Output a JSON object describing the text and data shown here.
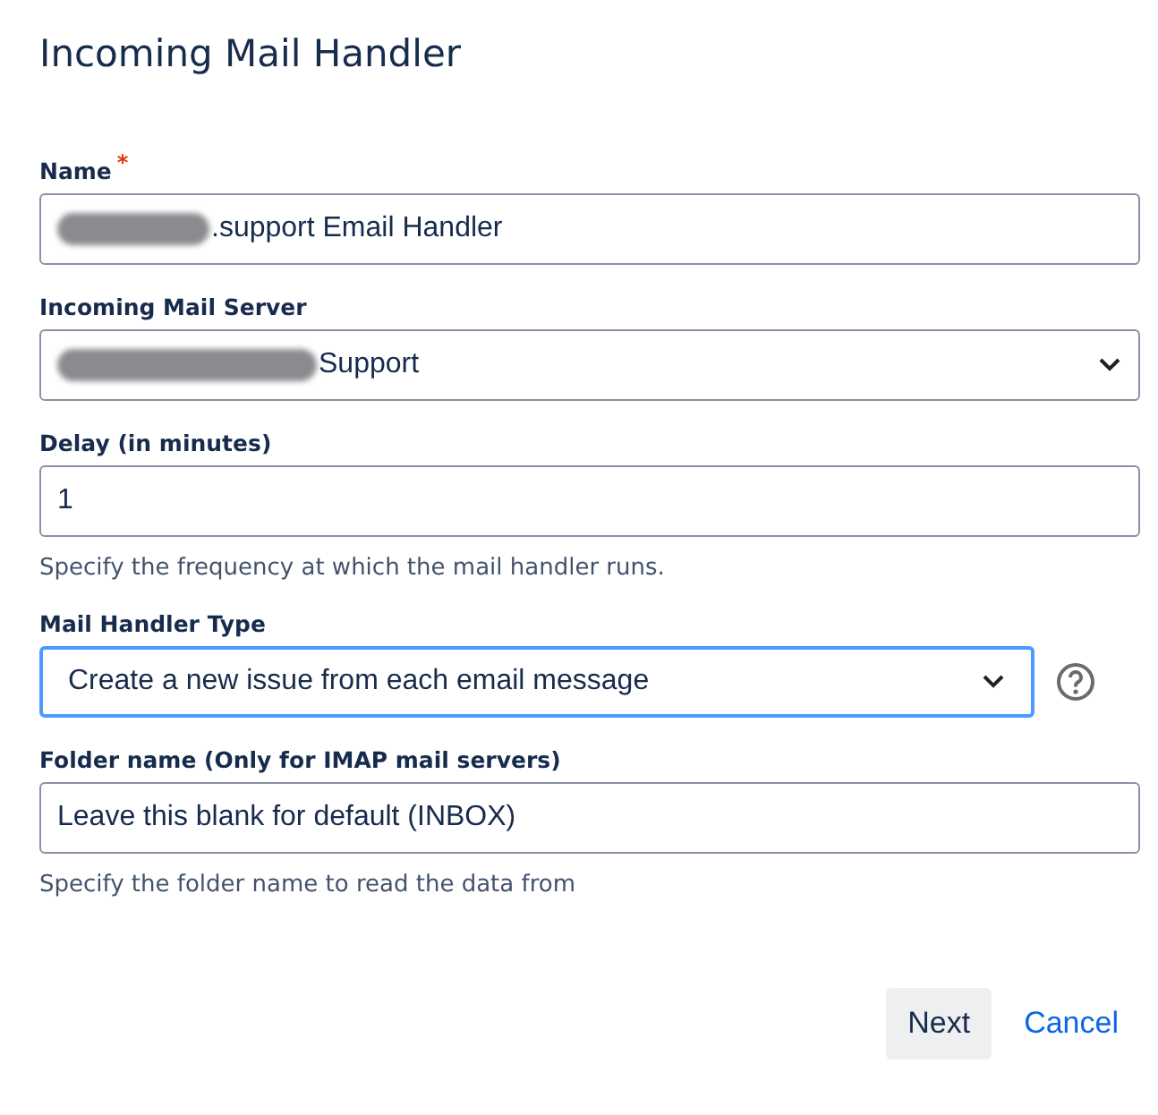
{
  "dialog": {
    "title": "Incoming Mail Handler"
  },
  "fields": [
    {
      "kind": "text",
      "label": "Name",
      "required_mark": "*",
      "value": ".support Email Handler",
      "redacted": true,
      "focused": false
    },
    {
      "kind": "select",
      "label": "Incoming Mail Server",
      "value": "Support",
      "redacted": true,
      "focused": false
    },
    {
      "kind": "text",
      "label": "Delay (in minutes)",
      "value": "1",
      "redacted": false,
      "focused": false,
      "help": "Specify the frequency at which the mail handler runs."
    },
    {
      "kind": "select",
      "label": "Mail Handler Type",
      "value": "Create a new issue from each email message",
      "redacted": false,
      "focused": true,
      "info": true
    },
    {
      "kind": "text",
      "label": "Folder name (Only for IMAP mail servers)",
      "value": "Leave this blank for default (INBOX)",
      "redacted": false,
      "focused": false,
      "help": "Specify the folder name to read the data from"
    }
  ],
  "buttons": [
    {
      "label": "Next",
      "kind": "primary"
    },
    {
      "label": "Cancel",
      "kind": "link"
    }
  ]
}
